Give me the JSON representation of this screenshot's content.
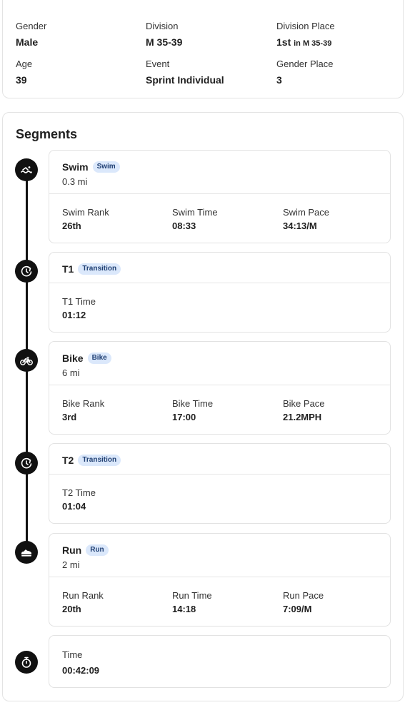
{
  "athlete_info": {
    "gender": {
      "label": "Gender",
      "value": "Male"
    },
    "division": {
      "label": "Division",
      "value": "M 35-39"
    },
    "division_place": {
      "label": "Division Place",
      "value": "1st",
      "suffix": "in M 35-39"
    },
    "age": {
      "label": "Age",
      "value": "39"
    },
    "event": {
      "label": "Event",
      "value": "Sprint Individual"
    },
    "gender_place": {
      "label": "Gender Place",
      "value": "3"
    }
  },
  "segments_section": {
    "title": "Segments",
    "segments": [
      {
        "name": "Swim",
        "badge": "Swim",
        "distance": "0.3 mi",
        "icon": "swim-icon",
        "stats": [
          {
            "label": "Swim Rank",
            "value": "26th"
          },
          {
            "label": "Swim Time",
            "value": "08:33"
          },
          {
            "label": "Swim Pace",
            "value": "34:13/M"
          }
        ]
      },
      {
        "name": "T1",
        "badge": "Transition",
        "icon": "transition-icon",
        "stats": [
          {
            "label": "T1 Time",
            "value": "01:12"
          }
        ]
      },
      {
        "name": "Bike",
        "badge": "Bike",
        "distance": "6 mi",
        "icon": "bike-icon",
        "stats": [
          {
            "label": "Bike Rank",
            "value": "3rd"
          },
          {
            "label": "Bike Time",
            "value": "17:00"
          },
          {
            "label": "Bike Pace",
            "value": "21.2MPH"
          }
        ]
      },
      {
        "name": "T2",
        "badge": "Transition",
        "icon": "transition-icon",
        "stats": [
          {
            "label": "T2 Time",
            "value": "01:04"
          }
        ]
      },
      {
        "name": "Run",
        "badge": "Run",
        "distance": "2 mi",
        "icon": "run-shoe-icon",
        "stats": [
          {
            "label": "Run Rank",
            "value": "20th"
          },
          {
            "label": "Run Time",
            "value": "14:18"
          },
          {
            "label": "Run Pace",
            "value": "7:09/M"
          }
        ]
      }
    ],
    "total": {
      "label": "Time",
      "value": "00:42:09",
      "icon": "stopwatch-icon"
    }
  },
  "colors": {
    "badge_bg": "#dbe8fb",
    "badge_text": "#1f3f73",
    "timeline": "#111111"
  }
}
